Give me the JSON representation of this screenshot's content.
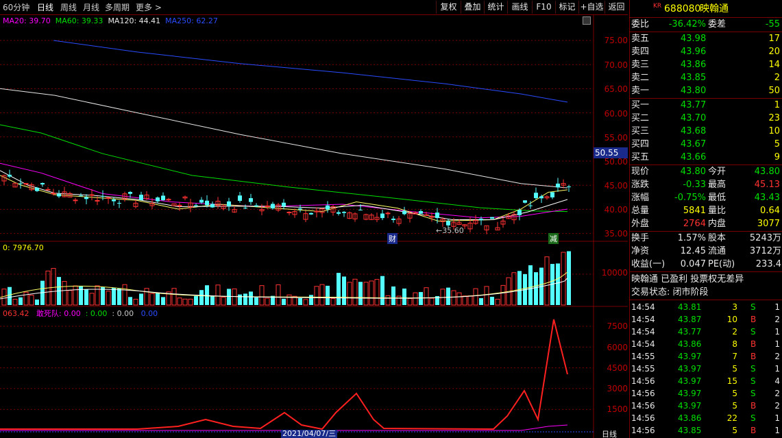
{
  "toolbar": {
    "periods": [
      "60分钟",
      "日线",
      "周线",
      "月线",
      "多周期",
      "更多 >"
    ],
    "buttons": [
      "复权",
      "叠加",
      "统计",
      "画线",
      "F10",
      "标记",
      "+自选",
      "返回"
    ]
  },
  "ma_legend": {
    "ma20": "MA20: 39.70",
    "ma60": "MA60: 39.33",
    "ma120": "MA120: 44.41",
    "ma250": "MA250: 62.27"
  },
  "price_axis": [
    "75.00",
    "70.00",
    "65.00",
    "60.00",
    "55.00",
    "50.00",
    "45.00",
    "40.00",
    "35.00"
  ],
  "current_price_tag": "50.55",
  "low_annotation": "←35.60",
  "markers": {
    "cai": "财",
    "jian": "减"
  },
  "volume_legend": "0: 7976.70",
  "volume_axis": [
    "10000"
  ],
  "indicator_legend": {
    "v1": "063.42",
    "v2": "敢死队: 0.00",
    "v3": ": 0.00",
    "v4": ": 0.00",
    "v5": "0.00"
  },
  "indicator_axis": [
    "7500",
    "6000",
    "4500",
    "3000",
    "1500"
  ],
  "date_tag": "2021/04/07/三",
  "bottom_tab": "日线",
  "quote": {
    "kr": "KR",
    "code": "688080",
    "name": "映翰通",
    "weibi_label": "委比",
    "weibi": "-36.42%",
    "weicha_label": "委差",
    "weicha": "-55",
    "asks": [
      {
        "label": "卖五",
        "price": "43.98",
        "vol": "17"
      },
      {
        "label": "卖四",
        "price": "43.96",
        "vol": "20"
      },
      {
        "label": "卖三",
        "price": "43.86",
        "vol": "14"
      },
      {
        "label": "卖二",
        "price": "43.85",
        "vol": "2"
      },
      {
        "label": "卖一",
        "price": "43.80",
        "vol": "50"
      }
    ],
    "bids": [
      {
        "label": "买一",
        "price": "43.77",
        "vol": "1"
      },
      {
        "label": "买二",
        "price": "43.70",
        "vol": "23"
      },
      {
        "label": "买三",
        "price": "43.68",
        "vol": "10"
      },
      {
        "label": "买四",
        "price": "43.67",
        "vol": "5"
      },
      {
        "label": "买五",
        "price": "43.66",
        "vol": "9"
      }
    ],
    "stats": [
      {
        "l1": "现价",
        "v1": "43.80",
        "l2": "今开",
        "v2": "43.80"
      },
      {
        "l1": "涨跌",
        "v1": "-0.33",
        "l2": "最高",
        "v2": "45.13"
      },
      {
        "l1": "涨幅",
        "v1": "-0.75%",
        "l2": "最低",
        "v2": "43.43"
      },
      {
        "l1": "总量",
        "v1": "5841",
        "l2": "量比",
        "v2": "0.64"
      },
      {
        "l1": "外盘",
        "v1": "2764",
        "l2": "内盘",
        "v2": "3077"
      }
    ],
    "stats2": [
      {
        "l1": "换手",
        "v1": "1.57%",
        "l2": "股本",
        "v2": "5243万"
      },
      {
        "l1": "净资",
        "v1": "12.45",
        "l2": "流通",
        "v2": "3712万"
      },
      {
        "l1": "收益(一)",
        "v1": "0.047",
        "l2": "PE(动)",
        "v2": "233.4"
      }
    ],
    "info1": "映翰通 已盈利 投票权无差异",
    "info2": "交易状态: 闭市阶段",
    "ticks": [
      {
        "time": "14:54",
        "price": "43.81",
        "vol": "3",
        "side": "S",
        "n": "1"
      },
      {
        "time": "14:54",
        "price": "43.87",
        "vol": "10",
        "side": "B",
        "n": "2"
      },
      {
        "time": "14:54",
        "price": "43.77",
        "vol": "2",
        "side": "S",
        "n": "1"
      },
      {
        "time": "14:54",
        "price": "43.86",
        "vol": "8",
        "side": "B",
        "n": "1"
      },
      {
        "time": "14:55",
        "price": "43.97",
        "vol": "7",
        "side": "B",
        "n": "2"
      },
      {
        "time": "14:55",
        "price": "43.97",
        "vol": "5",
        "side": "S",
        "n": "1"
      },
      {
        "time": "14:56",
        "price": "43.97",
        "vol": "15",
        "side": "S",
        "n": "4"
      },
      {
        "time": "14:56",
        "price": "43.97",
        "vol": "5",
        "side": "S",
        "n": "2"
      },
      {
        "time": "14:56",
        "price": "43.97",
        "vol": "5",
        "side": "B",
        "n": "2"
      },
      {
        "time": "14:56",
        "price": "43.86",
        "vol": "22",
        "side": "S",
        "n": "1"
      },
      {
        "time": "14:56",
        "price": "43.85",
        "vol": "5",
        "side": "B",
        "n": "1"
      }
    ]
  },
  "colors": {
    "up": "#ff3232",
    "down": "#54ffff",
    "ma20": "#ffffff",
    "ma60": "#00e000",
    "ma120": "#ff00ff",
    "ma250": "#2a4cff",
    "grid": "#7a0000"
  }
}
